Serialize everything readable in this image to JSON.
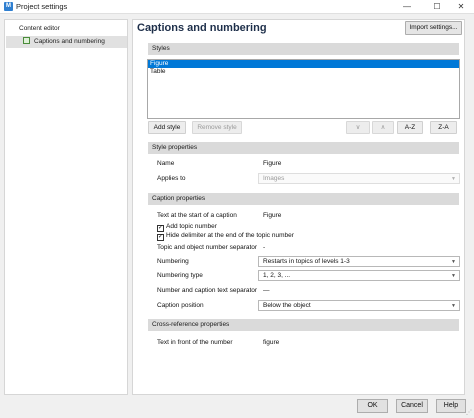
{
  "window": {
    "title": "Project settings",
    "app_icon_letter": "M",
    "minimize": "—",
    "maximize": "☐",
    "close": "✕"
  },
  "tree": {
    "items": [
      {
        "label": "Content editor"
      },
      {
        "label": "Captions and numbering"
      }
    ]
  },
  "header": {
    "title": "Captions and numbering",
    "import_label": "Import settings..."
  },
  "styles": {
    "heading": "Styles",
    "items": [
      "Figure",
      "Table"
    ],
    "selected": "Figure",
    "add_label": "Add style",
    "remove_label": "Remove style",
    "down_glyph": "∨",
    "up_glyph": "∧",
    "az_label": "A-Z",
    "za_label": "Z-A"
  },
  "style_properties": {
    "heading": "Style properties",
    "name_label": "Name",
    "name_value": "Figure",
    "applies_label": "Applies to",
    "applies_value": "Images"
  },
  "caption_properties": {
    "heading": "Caption properties",
    "text_start_label": "Text at the start of a caption",
    "text_start_value": "Figure",
    "add_topic_label": "Add topic number",
    "add_topic_checked": true,
    "hide_delim_label": "Hide delimiter at the end of the topic number",
    "hide_delim_checked": true,
    "separator_label": "Topic and object number separator",
    "separator_value": "-",
    "numbering_label": "Numbering",
    "numbering_value": "Restarts in topics of levels 1-3",
    "numbering_type_label": "Numbering type",
    "numbering_type_value": "1, 2, 3, ...",
    "text_sep_label": "Number and caption text separator",
    "text_sep_value": "—",
    "position_label": "Caption position",
    "position_value": "Below the object",
    "check_mark": "✓",
    "dropdown_glyph": "▼"
  },
  "cross_reference": {
    "heading": "Cross-reference properties",
    "front_label": "Text in front of the number",
    "front_value": "figure"
  },
  "footer": {
    "ok": "OK",
    "cancel": "Cancel",
    "help": "Help",
    "grip": "⋰"
  },
  "colors": {
    "selection": "#0078d7",
    "title": "#1e2f4a",
    "section": "#dadada"
  }
}
